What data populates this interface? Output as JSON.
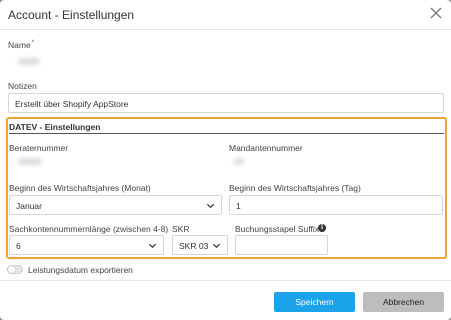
{
  "dialog": {
    "title": "Account - Einstellungen"
  },
  "name": {
    "label": "Name",
    "required_marker": "*"
  },
  "notizen": {
    "label": "Notizen",
    "value": "Erstellt über Shopify AppStore"
  },
  "datev": {
    "section_title": "DATEV - Einstellungen",
    "beraternummer_label": "Beraternummer",
    "mandantennummer_label": "Mandantennummer",
    "wj_monat_label": "Beginn des Wirtschaftsjahres (Monat)",
    "wj_monat_value": "Januar",
    "wj_tag_label": "Beginn des Wirtschaftsjahres (Tag)",
    "wj_tag_value": "1",
    "sachkonten_label": "Sachkontennummernlänge (zwischen 4-8)",
    "sachkonten_value": "6",
    "skr_label": "SKR",
    "skr_value": "SKR 03",
    "suffix_label": "Buchungsstapel Suffix",
    "suffix_value": ""
  },
  "leistungsdatum": {
    "label": "Leistungsdatum exportieren",
    "enabled": false
  },
  "buttons": {
    "save": "Speichern",
    "cancel": "Abbrechen"
  },
  "colors": {
    "highlight": "#f0a23a",
    "primary": "#1aa3e8",
    "secondary": "#bdbdbd"
  }
}
